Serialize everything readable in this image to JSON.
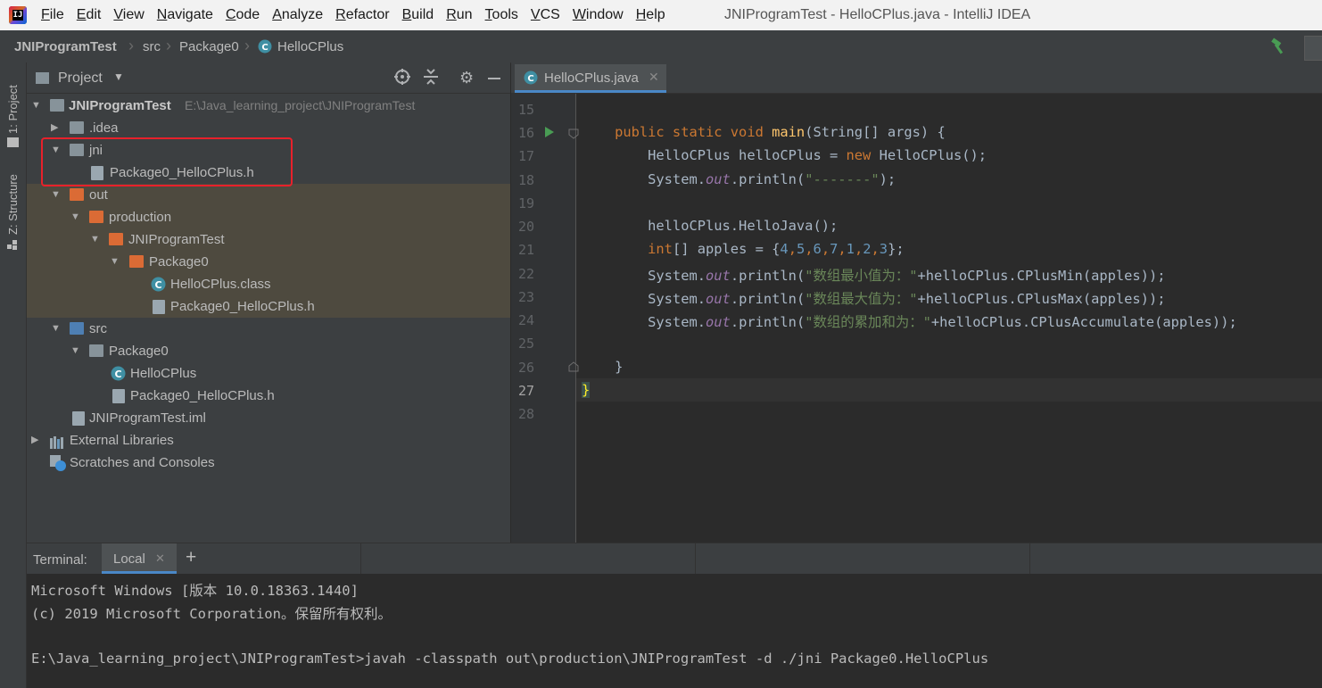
{
  "menubar": {
    "app_icon_text": "IJ",
    "items": [
      "File",
      "Edit",
      "View",
      "Navigate",
      "Code",
      "Analyze",
      "Refactor",
      "Build",
      "Run",
      "Tools",
      "VCS",
      "Window",
      "Help"
    ],
    "window_title": "JNIProgramTest - HelloCPlus.java - IntelliJ IDEA"
  },
  "breadcrumb": [
    "JNIProgramTest",
    "src",
    "Package0",
    "HelloCPlus"
  ],
  "stripe": {
    "project": "1: Project",
    "structure": "Z: Structure"
  },
  "project_panel": {
    "title": "Project",
    "tree": [
      {
        "label": "JNIProgramTest",
        "extra": "E:\\Java_learning_project\\JNIProgramTest"
      },
      {
        "label": ".idea"
      },
      {
        "label": "jni"
      },
      {
        "label": "Package0_HelloCPlus.h"
      },
      {
        "label": "out"
      },
      {
        "label": "production"
      },
      {
        "label": "JNIProgramTest"
      },
      {
        "label": "Package0"
      },
      {
        "label": "HelloCPlus.class"
      },
      {
        "label": "Package0_HelloCPlus.h"
      },
      {
        "label": "src"
      },
      {
        "label": "Package0"
      },
      {
        "label": "HelloCPlus"
      },
      {
        "label": "Package0_HelloCPlus.h"
      },
      {
        "label": "JNIProgramTest.iml"
      },
      {
        "label": "External Libraries"
      },
      {
        "label": "Scratches and Consoles"
      }
    ]
  },
  "editor": {
    "tab_label": "HelloCPlus.java",
    "line_numbers": [
      "15",
      "16",
      "17",
      "18",
      "19",
      "20",
      "21",
      "22",
      "23",
      "24",
      "25",
      "26",
      "27",
      "28"
    ],
    "code": {
      "l16_a": "    public static void ",
      "l16_b": "main",
      "l16_c": "(String[] args) {",
      "l17_a": "        HelloCPlus helloCPlus = ",
      "l17_b": "new ",
      "l17_c": "HelloCPlus();",
      "l18_a": "        System.",
      "l18_b": "out",
      "l18_c": ".println(",
      "l18_d": "\"-------\"",
      "l18_e": ");",
      "l20": "        helloCPlus.HelloJava();",
      "l21_a": "        int",
      "l21_b": "[] apples = {",
      "l21_c": "4",
      "l21_d": "5",
      "l21_e": "6",
      "l21_f": "7",
      "l21_g": "1",
      "l21_h": "2",
      "l21_i": "3",
      "l21_j": "};",
      "l22_d": "\"数组最小值为：\"",
      "l22_e": "+helloCPlus.CPlusMin(apples));",
      "l23_d": "\"数组最大值为：\"",
      "l23_e": "+helloCPlus.CPlusMax(apples));",
      "l24_d": "\"数组的累加和为：\"",
      "l24_e": "+helloCPlus.CPlusAccumulate(apples));",
      "l26": "    }",
      "l27": "}"
    }
  },
  "terminal": {
    "label": "Terminal:",
    "tab": "Local",
    "add": "+",
    "lines": [
      "Microsoft Windows [版本 10.0.18363.1440]",
      "(c) 2019 Microsoft Corporation。保留所有权利。",
      "",
      "E:\\Java_learning_project\\JNIProgramTest>javah -classpath out\\production\\JNIProgramTest -d ./jni Package0.HelloCPlus"
    ]
  }
}
